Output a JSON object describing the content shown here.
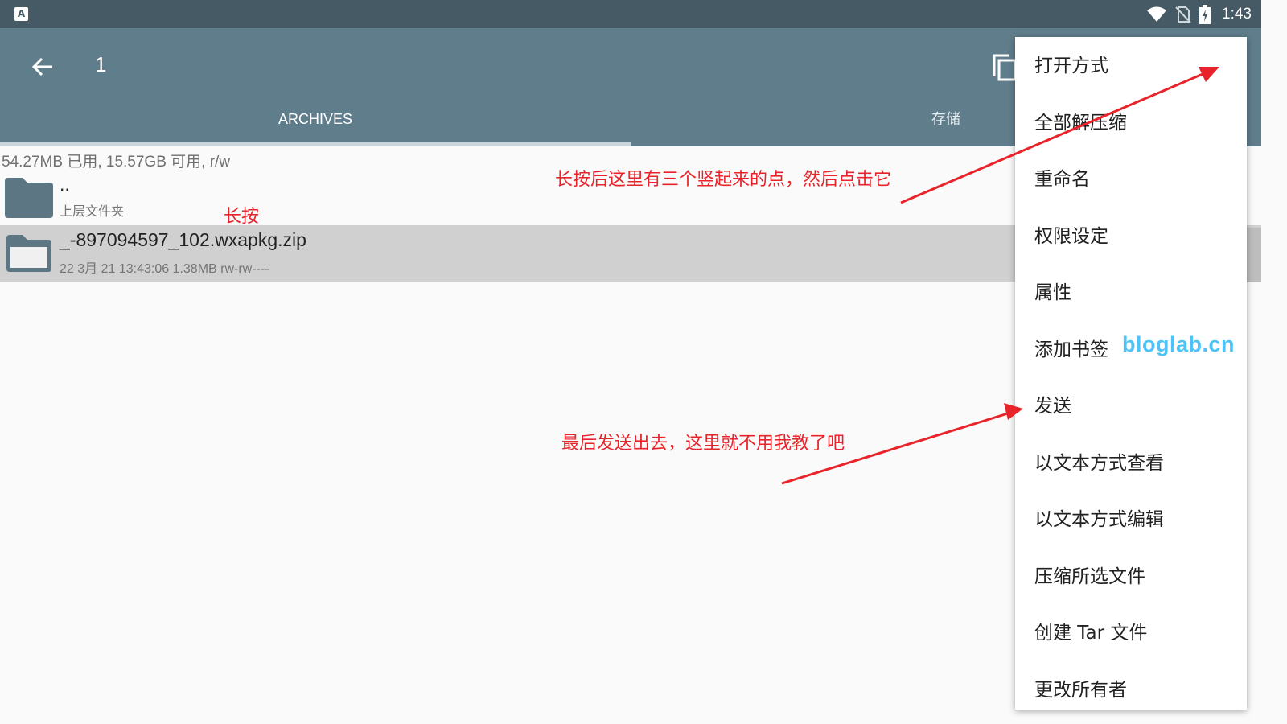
{
  "status_bar": {
    "app_icon": "A",
    "time": "1:43",
    "icons": [
      "wifi-icon",
      "no-sim-icon",
      "battery-charging-icon"
    ]
  },
  "appbar": {
    "title": "1",
    "back_icon": "arrow-back-icon",
    "copy_icon": "copy-icon"
  },
  "tabs": [
    {
      "label": "ARCHIVES",
      "selected": true
    },
    {
      "label": "存储",
      "selected": false
    }
  ],
  "storage_info": "54.27MB 已用, 15.57GB 可用, r/w",
  "files": [
    {
      "name": "..",
      "sub": "上层文件夹"
    },
    {
      "name": "_-897094597_102.wxapkg.zip",
      "sub": "22 3月 21 13:43:06  1.38MB  rw-rw----",
      "selected": true
    }
  ],
  "context_menu": [
    "打开方式",
    "全部解压缩",
    "重命名",
    "权限设定",
    "属性",
    "添加书签",
    "发送",
    "以文本方式查看",
    "以文本方式编辑",
    "压缩所选文件",
    "创建 Tar 文件",
    "更改所有者"
  ],
  "annotations": {
    "long_press": "长按",
    "dots_hint": "长按后这里有三个竖起来的点，然后点击它",
    "send_hint": "最后发送出去，这里就不用我教了吧",
    "arrow_color": "#e8232a"
  },
  "watermark": "bloglab.cn",
  "colors": {
    "status_bar": "#455a64",
    "app_bar": "#607d8b",
    "selected_row": "#d0d0d0",
    "folder": "#5d7683"
  }
}
